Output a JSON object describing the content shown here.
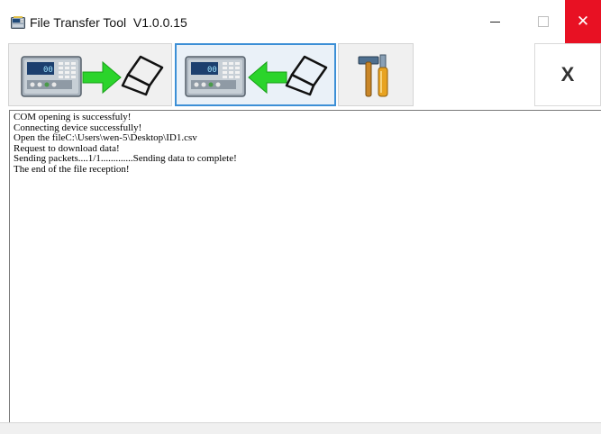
{
  "window": {
    "title": "File Transfer Tool  V1.0.0.15",
    "app_icon": "terminal-scale-icon",
    "controls": {
      "minimize_icon": "minimize-icon",
      "maximize_icon": "maximize-icon",
      "close_icon": "close-icon",
      "close_glyph": "✕",
      "close_color": "#e81123"
    }
  },
  "toolbar": {
    "upload_icon": "upload-to-device-icon",
    "download_icon": "download-from-device-icon",
    "settings_icon": "tools-settings-icon",
    "exit_label": "X",
    "accent": "#3c8fd6",
    "arrow_color": "#27c827"
  },
  "log": {
    "lines": [
      "COM opening is successfuly!",
      "Connecting device successfully!",
      "Open the fileC:\\Users\\wen-5\\Desktop\\ID1.csv",
      "Request to download data!",
      "Sending packets....1/1.............Sending data to complete!",
      "The end of the file reception!"
    ]
  }
}
